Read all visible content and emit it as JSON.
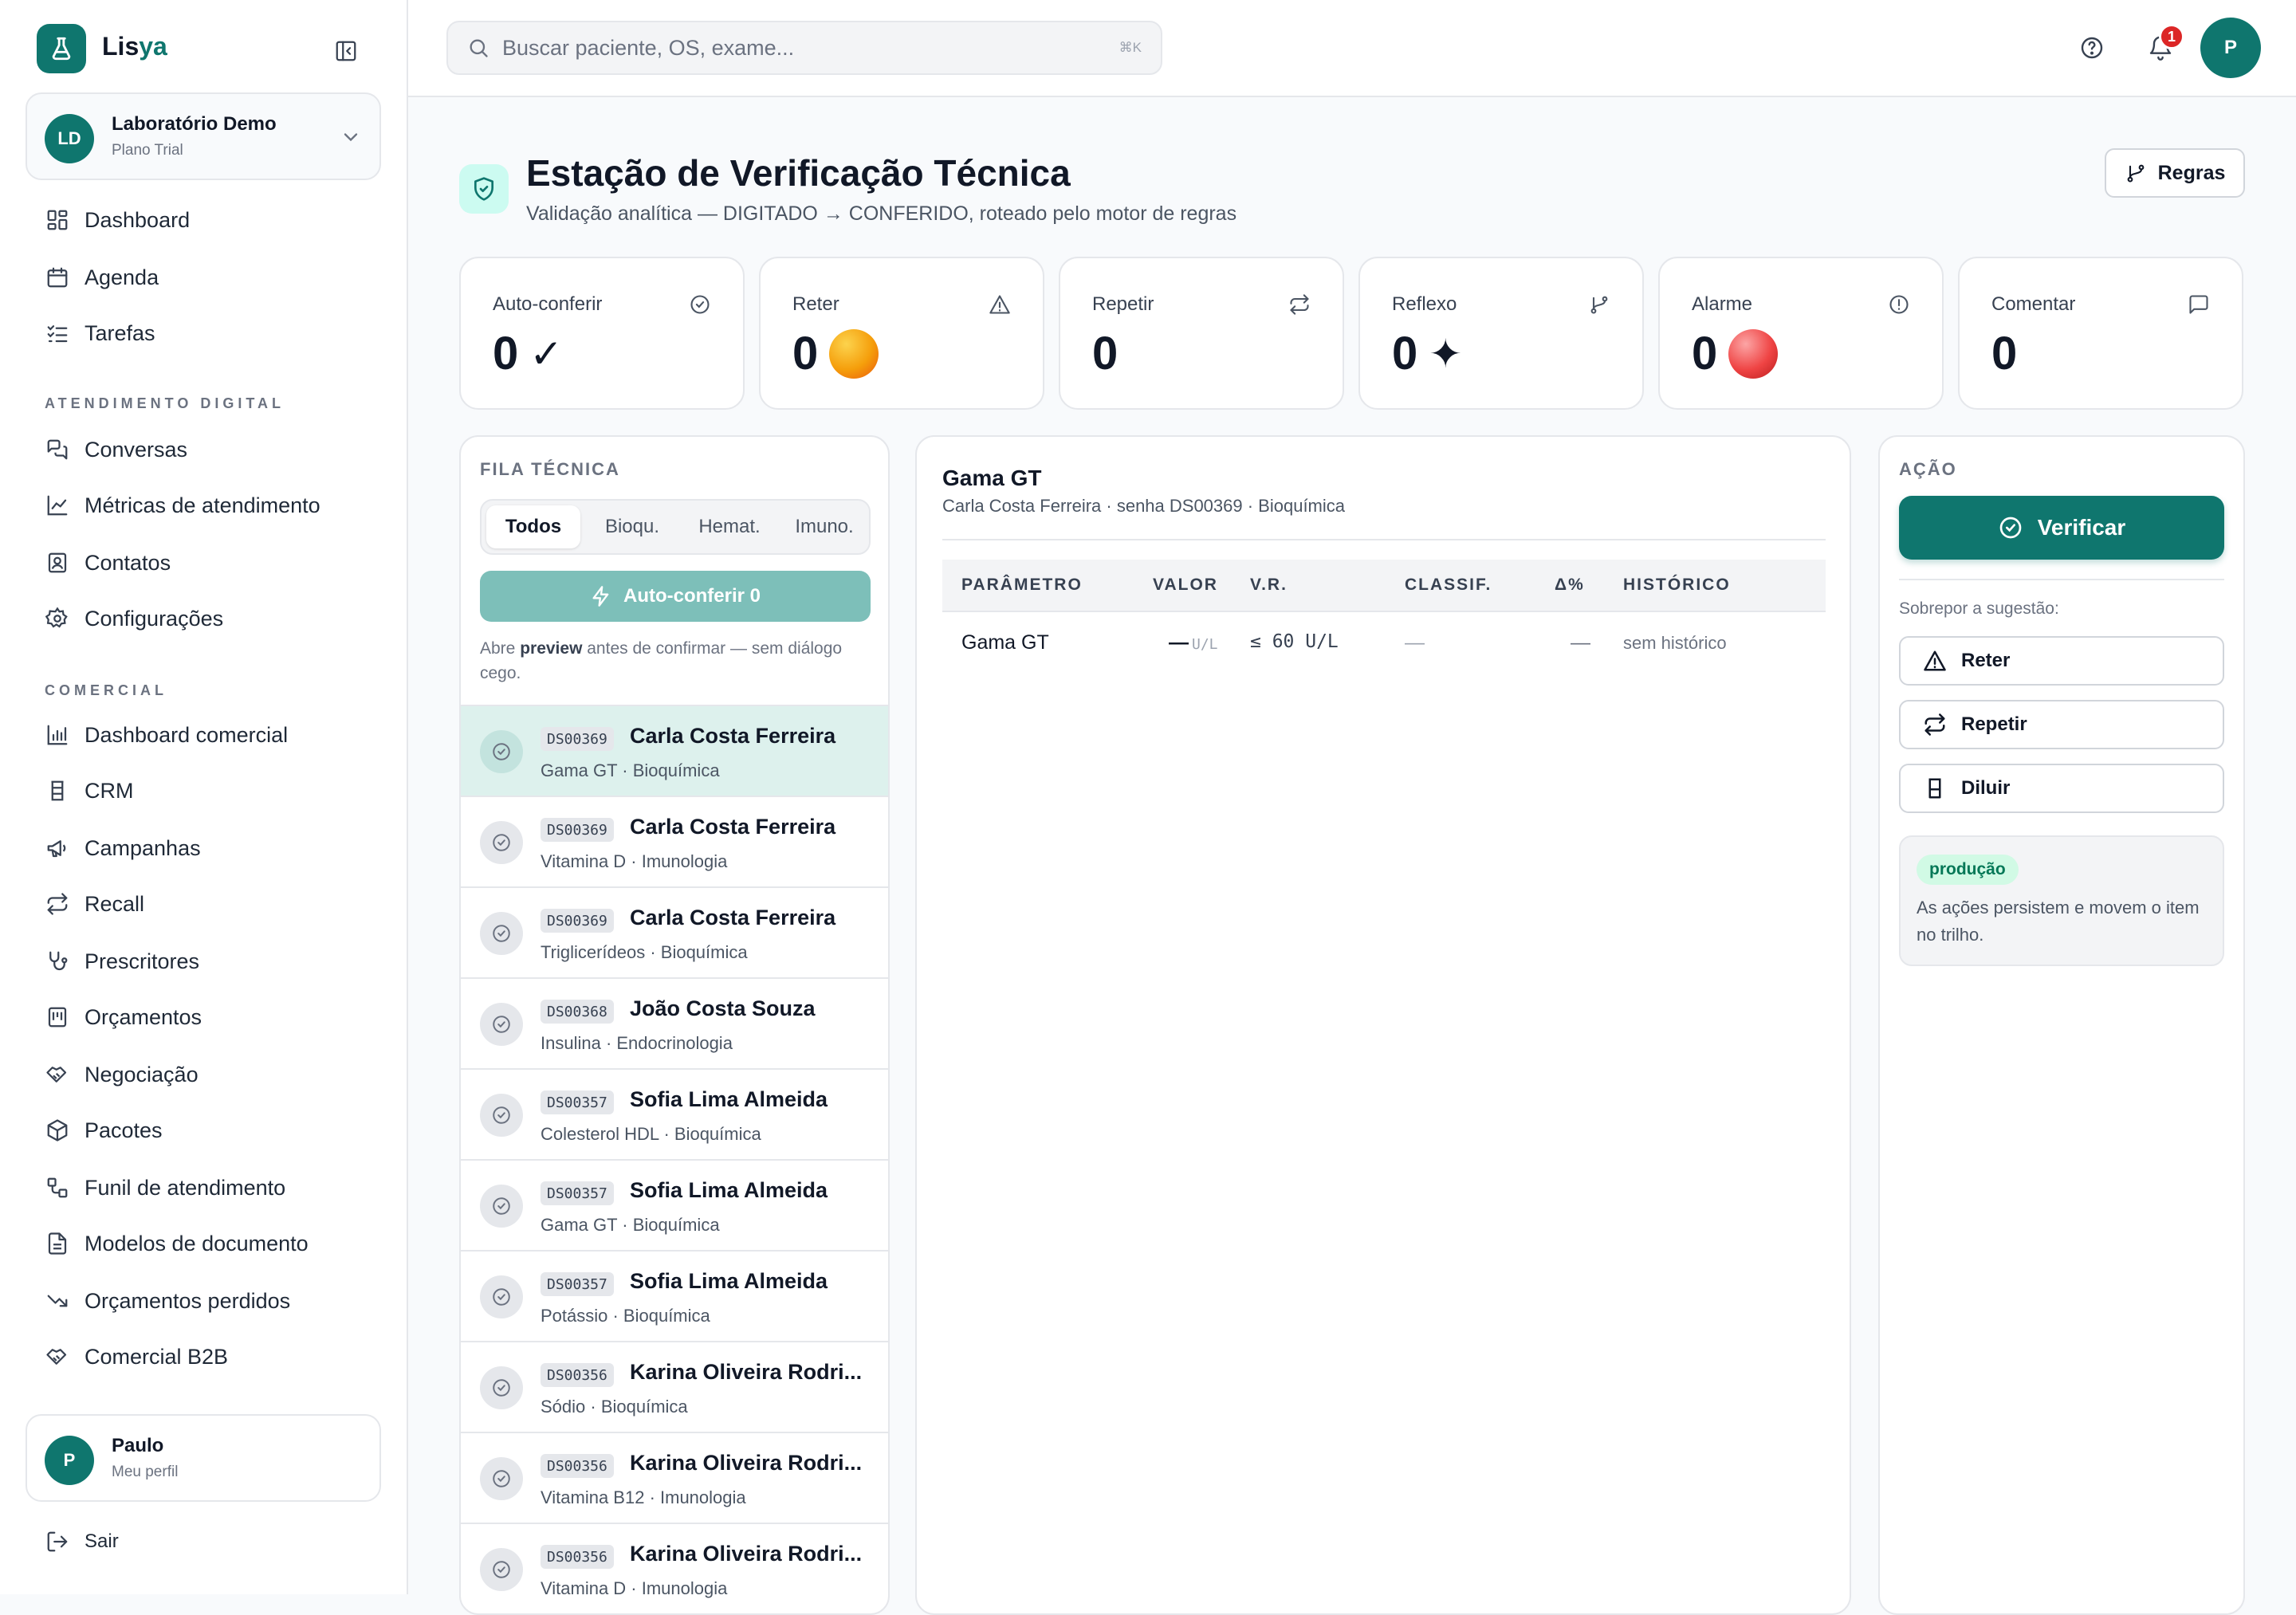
{
  "app": {
    "brand_a": "Lis",
    "brand_b": "ya"
  },
  "org": {
    "initials": "LD",
    "name": "Laboratório Demo",
    "plan": "Plano Trial"
  },
  "nav": {
    "main": [
      "Dashboard",
      "Agenda",
      "Tarefas"
    ],
    "section_digital": "ATENDIMENTO DIGITAL",
    "digital": [
      "Conversas",
      "Métricas de atendimento",
      "Contatos",
      "Configurações"
    ],
    "section_comercial": "COMERCIAL",
    "comercial": [
      "Dashboard comercial",
      "CRM",
      "Campanhas",
      "Recall",
      "Prescritores",
      "Orçamentos",
      "Negociação",
      "Pacotes",
      "Funil de atendimento",
      "Modelos de documento",
      "Orçamentos perdidos",
      "Comercial B2B"
    ]
  },
  "user": {
    "initial": "P",
    "name": "Paulo",
    "sub": "Meu perfil",
    "logout": "Sair"
  },
  "topbar": {
    "search_placeholder": "Buscar paciente, OS, exame...",
    "shortcut": "⌘K",
    "notif_count": "1",
    "avatar": "P"
  },
  "page": {
    "title": "Estação de Verificação Técnica",
    "subtitle": "Validação analítica — DIGITADO → CONFERIDO, roteado pelo motor de regras",
    "rules_button": "Regras"
  },
  "stats": [
    {
      "label": "Auto-conferir",
      "value": "0",
      "symbol": "✓",
      "icon": "check-circle-icon"
    },
    {
      "label": "Reter",
      "value": "0",
      "dot": "#f59e0b",
      "icon": "alert-triangle-icon"
    },
    {
      "label": "Repetir",
      "value": "0",
      "icon": "repeat-icon"
    },
    {
      "label": "Reflexo",
      "value": "0",
      "symbol": "✦",
      "icon": "git-branch-icon"
    },
    {
      "label": "Alarme",
      "value": "0",
      "dot": "#dc2626",
      "icon": "alert-circle-icon"
    },
    {
      "label": "Comentar",
      "value": "0",
      "icon": "message-square-icon"
    }
  ],
  "queue": {
    "label": "FILA TÉCNICA",
    "tabs": [
      "Todos",
      "Bioqu.",
      "Hemat.",
      "Imuno."
    ],
    "auto_button": "Auto-conferir 0",
    "hint_a": "Abre ",
    "hint_b": "preview",
    "hint_c": " antes de confirmar — sem diálogo cego.",
    "items": [
      {
        "code": "DS00369",
        "name": "Carla Costa Ferreira",
        "sub": "Gama GT · Bioquímica"
      },
      {
        "code": "DS00369",
        "name": "Carla Costa Ferreira",
        "sub": "Vitamina D · Imunologia"
      },
      {
        "code": "DS00369",
        "name": "Carla Costa Ferreira",
        "sub": "Triglicerídeos · Bioquímica"
      },
      {
        "code": "DS00368",
        "name": "João Costa Souza",
        "sub": "Insulina · Endocrinologia"
      },
      {
        "code": "DS00357",
        "name": "Sofia Lima Almeida",
        "sub": "Colesterol HDL · Bioquímica"
      },
      {
        "code": "DS00357",
        "name": "Sofia Lima Almeida",
        "sub": "Gama GT · Bioquímica"
      },
      {
        "code": "DS00357",
        "name": "Sofia Lima Almeida",
        "sub": "Potássio · Bioquímica"
      },
      {
        "code": "DS00356",
        "name": "Karina Oliveira Rodri...",
        "sub": "Sódio · Bioquímica"
      },
      {
        "code": "DS00356",
        "name": "Karina Oliveira Rodri...",
        "sub": "Vitamina B12 · Imunologia"
      },
      {
        "code": "DS00356",
        "name": "Karina Oliveira Rodri...",
        "sub": "Vitamina D · Imunologia"
      }
    ]
  },
  "detail": {
    "title": "Gama GT",
    "subtitle": "Carla Costa Ferreira · senha DS00369 · Bioquímica",
    "columns": [
      "PARÂMETRO",
      "VALOR",
      "V.R.",
      "CLASSIF.",
      "Δ%",
      "HISTÓRICO"
    ],
    "row": {
      "param": "Gama GT",
      "value": "—",
      "unit": "U/L",
      "ref": "≤ 60 U/L",
      "classif": "—",
      "delta": "—",
      "history": "sem histórico"
    }
  },
  "action": {
    "label": "AÇÃO",
    "verify": "Verificar",
    "override_label": "Sobrepor a sugestão:",
    "buttons": [
      "Reter",
      "Repetir",
      "Diluir"
    ],
    "pill": "produção",
    "info": "As ações persistem e movem o item no trilho."
  }
}
